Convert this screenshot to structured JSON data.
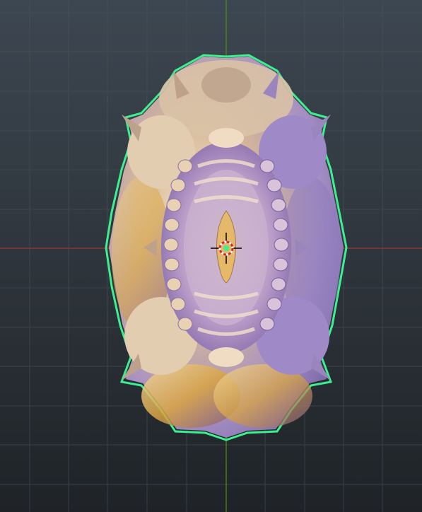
{
  "viewport": {
    "background_top": "#3d4751",
    "background_bottom": "#1f2327",
    "grid_color": "#4a545e",
    "x_axis_color": "#a3333a",
    "y_axis_color": "#4b8a1f",
    "selection_outline_color": "#3df08f"
  },
  "object": {
    "material_light": "#e8d5b8",
    "material_mid": "#c8a888",
    "material_shadow": "#8f7bbf",
    "material_gold": "#d9a441"
  },
  "cursor_3d": {
    "ring_colors": [
      "#d22828",
      "#ffffff"
    ],
    "crosshair_color": "#000000"
  }
}
